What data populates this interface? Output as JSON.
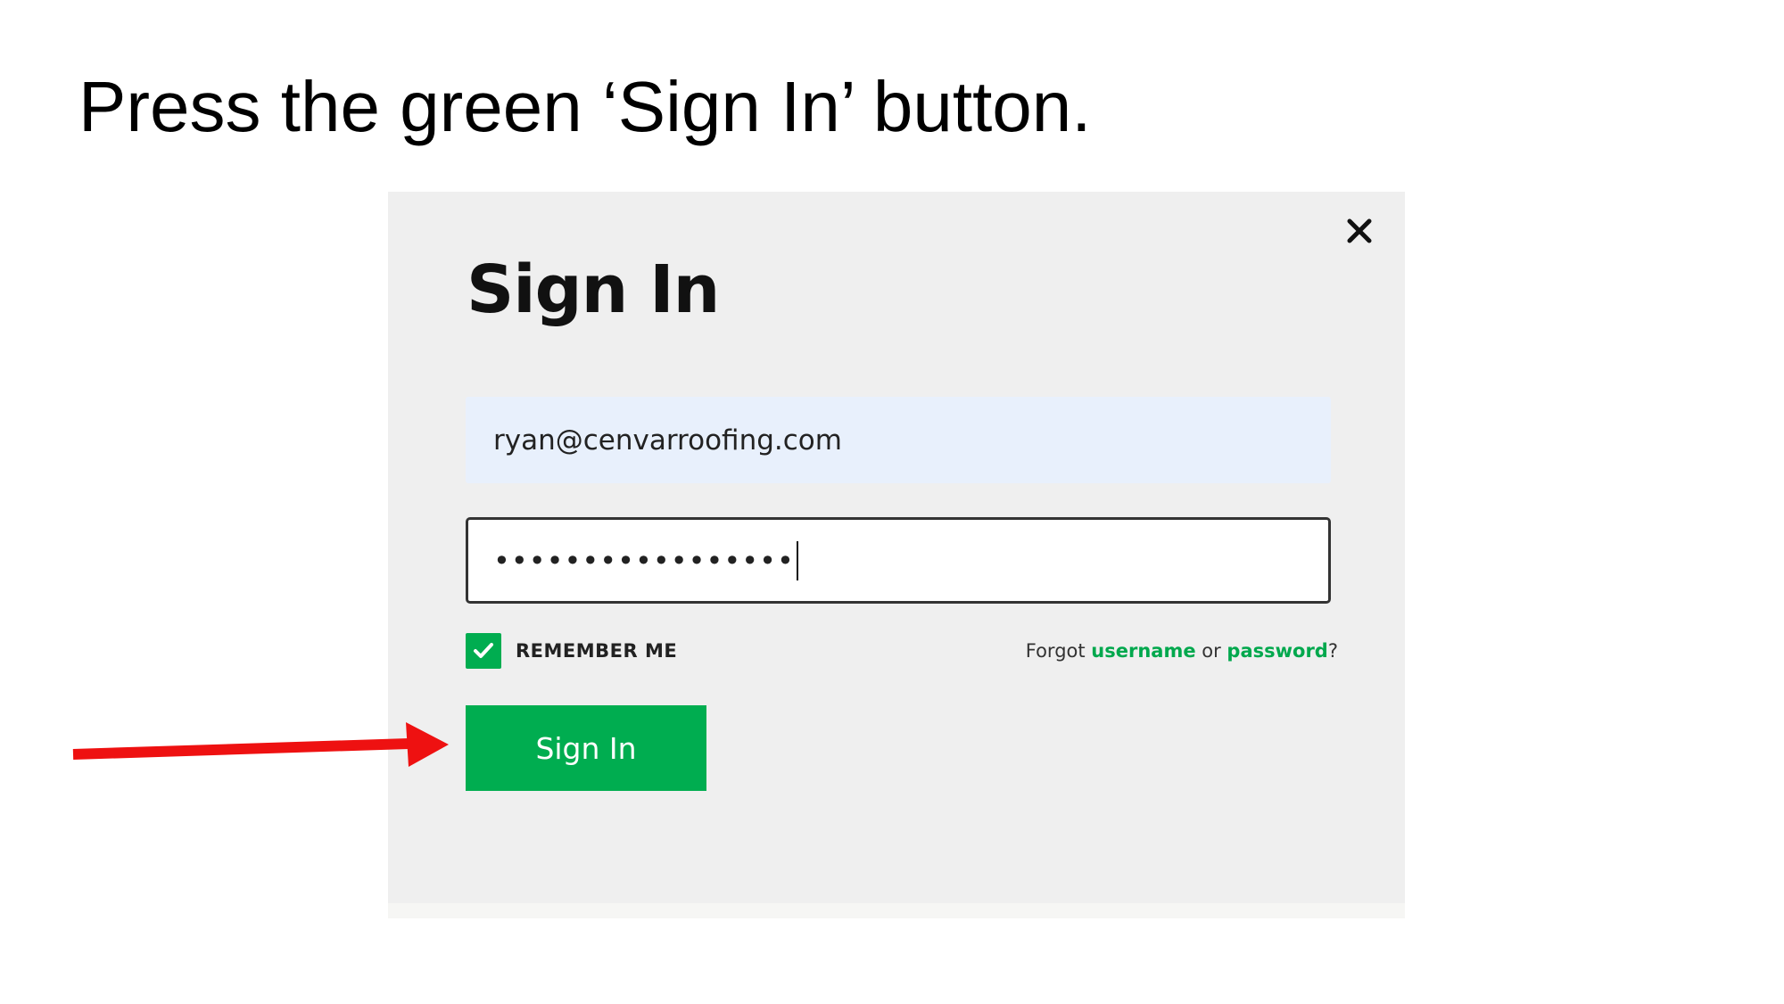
{
  "instruction": {
    "text": "Press the green ‘Sign In’ button."
  },
  "modal": {
    "title": "Sign In",
    "email_value": "ryan@cenvarroofing.com",
    "password_masked": "•••••••••••••••••",
    "remember_label": "REMEMBER ME",
    "remember_checked": true,
    "forgot": {
      "prefix": "Forgot ",
      "username_link": "username",
      "middle": " or ",
      "password_link": "password",
      "suffix": "?"
    },
    "signin_button": "Sign In"
  },
  "icons": {
    "close": "close-icon",
    "check": "check-icon",
    "arrow": "red-arrow-icon"
  },
  "colors": {
    "accent_green": "#00ad50",
    "link_green": "#00a84d",
    "arrow_red": "#ee1111",
    "modal_bg": "#efefef",
    "email_field_bg": "#e8f0fc"
  }
}
